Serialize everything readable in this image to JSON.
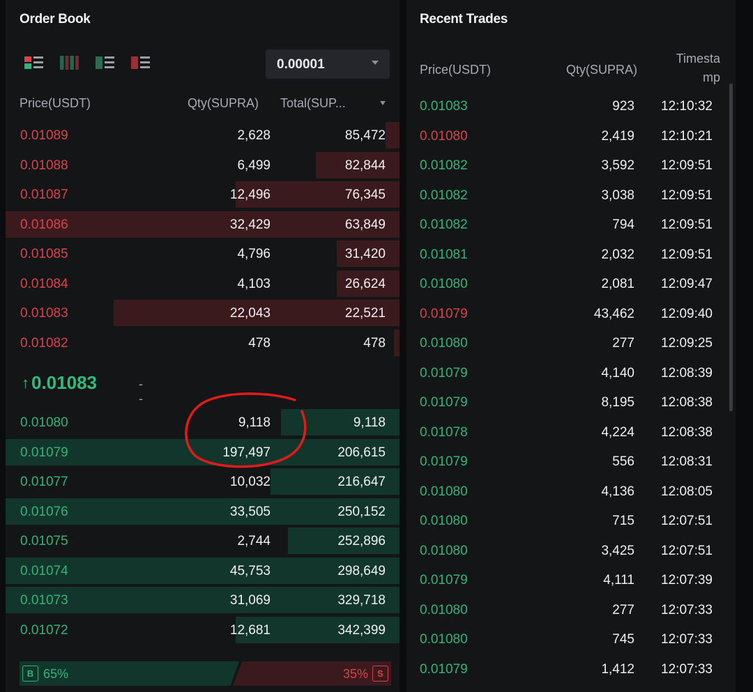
{
  "order_book": {
    "title": "Order Book",
    "precision": "0.00001",
    "columns": [
      "Price(USDT)",
      "Qty(SUPRA)",
      "Total(SUP..."
    ],
    "asks": [
      {
        "price": "0.01089",
        "qty": "2,628",
        "total": "85,472"
      },
      {
        "price": "0.01088",
        "qty": "6,499",
        "total": "82,844"
      },
      {
        "price": "0.01087",
        "qty": "12,496",
        "total": "76,345"
      },
      {
        "price": "0.01086",
        "qty": "32,429",
        "total": "63,849"
      },
      {
        "price": "0.01085",
        "qty": "4,796",
        "total": "31,420"
      },
      {
        "price": "0.01084",
        "qty": "4,103",
        "total": "26,624"
      },
      {
        "price": "0.01083",
        "qty": "22,043",
        "total": "22,521"
      },
      {
        "price": "0.01082",
        "qty": "478",
        "total": "478"
      }
    ],
    "last_price": "0.01083",
    "last_price_arrow": "↑",
    "mark_price": "--",
    "bids": [
      {
        "price": "0.01080",
        "qty": "9,118",
        "total": "9,118"
      },
      {
        "price": "0.01079",
        "qty": "197,497",
        "total": "206,615"
      },
      {
        "price": "0.01077",
        "qty": "10,032",
        "total": "216,647"
      },
      {
        "price": "0.01076",
        "qty": "33,505",
        "total": "250,152"
      },
      {
        "price": "0.01075",
        "qty": "2,744",
        "total": "252,896"
      },
      {
        "price": "0.01074",
        "qty": "45,753",
        "total": "298,649"
      },
      {
        "price": "0.01073",
        "qty": "31,069",
        "total": "329,718"
      },
      {
        "price": "0.01072",
        "qty": "12,681",
        "total": "342,399"
      }
    ],
    "buy_badge": "B",
    "buy_pct": "65%",
    "sell_pct": "35%",
    "sell_badge": "S",
    "colors": {
      "ask": "#d8434e",
      "bid": "#2fb57a",
      "annotation": "#e01b1b"
    }
  },
  "recent_trades": {
    "title": "Recent Trades",
    "columns": [
      "Price(USDT)",
      "Qty(SUPRA)",
      "Timesta",
      "mp"
    ],
    "trades": [
      {
        "price": "0.01083",
        "side": "buy",
        "qty": "923",
        "time": "12:10:32"
      },
      {
        "price": "0.01080",
        "side": "sell",
        "qty": "2,419",
        "time": "12:10:21"
      },
      {
        "price": "0.01082",
        "side": "buy",
        "qty": "3,592",
        "time": "12:09:51"
      },
      {
        "price": "0.01082",
        "side": "buy",
        "qty": "3,038",
        "time": "12:09:51"
      },
      {
        "price": "0.01082",
        "side": "buy",
        "qty": "794",
        "time": "12:09:51"
      },
      {
        "price": "0.01081",
        "side": "buy",
        "qty": "2,032",
        "time": "12:09:51"
      },
      {
        "price": "0.01080",
        "side": "buy",
        "qty": "2,081",
        "time": "12:09:47"
      },
      {
        "price": "0.01079",
        "side": "sell",
        "qty": "43,462",
        "time": "12:09:40"
      },
      {
        "price": "0.01080",
        "side": "buy",
        "qty": "277",
        "time": "12:09:25"
      },
      {
        "price": "0.01079",
        "side": "buy",
        "qty": "4,140",
        "time": "12:08:39"
      },
      {
        "price": "0.01079",
        "side": "buy",
        "qty": "8,195",
        "time": "12:08:38"
      },
      {
        "price": "0.01078",
        "side": "buy",
        "qty": "4,224",
        "time": "12:08:38"
      },
      {
        "price": "0.01079",
        "side": "buy",
        "qty": "556",
        "time": "12:08:31"
      },
      {
        "price": "0.01080",
        "side": "buy",
        "qty": "4,136",
        "time": "12:08:05"
      },
      {
        "price": "0.01080",
        "side": "buy",
        "qty": "715",
        "time": "12:07:51"
      },
      {
        "price": "0.01080",
        "side": "buy",
        "qty": "3,425",
        "time": "12:07:51"
      },
      {
        "price": "0.01079",
        "side": "buy",
        "qty": "4,111",
        "time": "12:07:39"
      },
      {
        "price": "0.01080",
        "side": "buy",
        "qty": "277",
        "time": "12:07:33"
      },
      {
        "price": "0.01080",
        "side": "buy",
        "qty": "745",
        "time": "12:07:33"
      },
      {
        "price": "0.01079",
        "side": "buy",
        "qty": "1,412",
        "time": "12:07:33"
      }
    ]
  }
}
